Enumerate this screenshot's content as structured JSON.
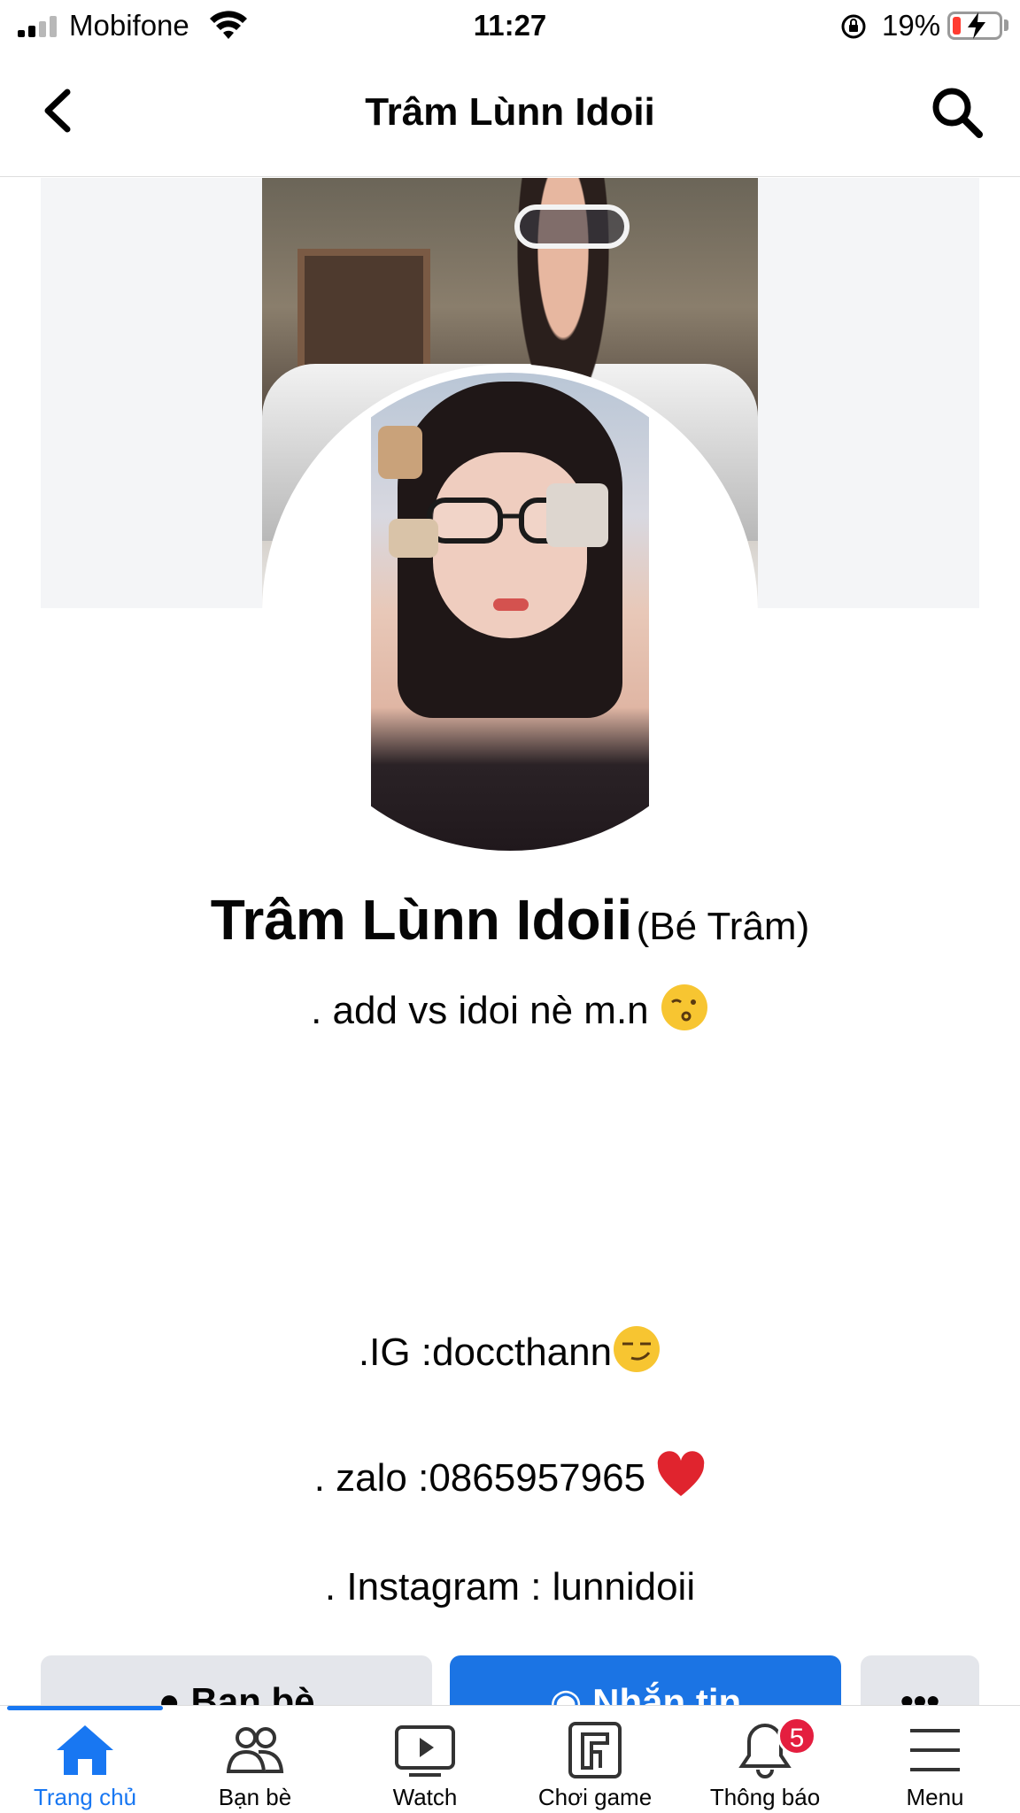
{
  "status_bar": {
    "carrier": "Mobifone",
    "time": "11:27",
    "battery_percent": "19%",
    "signal_bars_filled": 2,
    "signal_bars_total": 4,
    "battery_level": 0.19,
    "battery_color": "#ff3b30"
  },
  "header": {
    "title": "Trâm Lùnn Idoii",
    "back_icon": "chevron-left-icon",
    "search_icon": "search-icon"
  },
  "profile": {
    "name": "Trâm Lùnn Idoii",
    "alternate_name": "(Bé Trâm)",
    "bio": [
      ". add vs idoi nè m.n",
      ".IG :doccthann",
      ". zalo :0865957965",
      ". Instagram : lunnidoii"
    ],
    "bio_emojis": [
      "kissing-face-emoji",
      "smirking-face-emoji",
      "red-heart-emoji"
    ]
  },
  "actions": {
    "friends_label": "Bạn bè",
    "message_label": "Nhắn tin",
    "more_label": "•••"
  },
  "tabbar": {
    "items": [
      {
        "label": "Trang chủ",
        "icon": "home-icon",
        "active": true
      },
      {
        "label": "Bạn bè",
        "icon": "friends-icon",
        "active": false
      },
      {
        "label": "Watch",
        "icon": "watch-icon",
        "active": false
      },
      {
        "label": "Chơi game",
        "icon": "gaming-icon",
        "active": false
      },
      {
        "label": "Thông báo",
        "icon": "bell-icon",
        "active": false,
        "badge": "5"
      },
      {
        "label": "Menu",
        "icon": "menu-icon",
        "active": false
      }
    ]
  },
  "colors": {
    "accent": "#1877f2",
    "message_button": "#1b74e4",
    "badge": "#e41e3f",
    "secondary_button": "#e4e6eb"
  }
}
